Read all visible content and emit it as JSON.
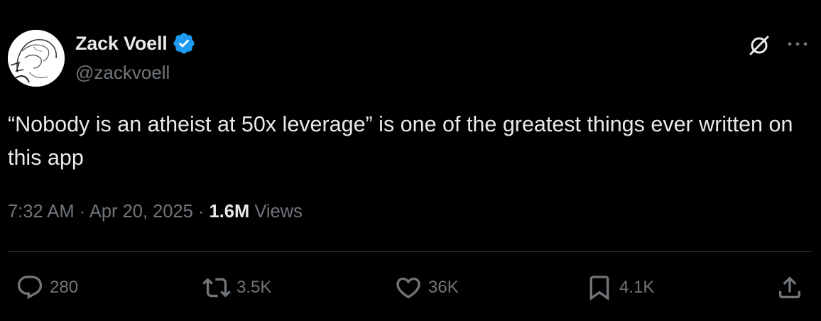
{
  "author": {
    "display_name": "Zack Voell",
    "handle": "@zackvoell",
    "verified": true
  },
  "tweet": {
    "text": "“Nobody is an atheist at 50x leverage” is one of the greatest things ever written on this app"
  },
  "meta": {
    "time": "7:32 AM",
    "separator": " · ",
    "date": "Apr 20, 2025",
    "views_count": "1.6M",
    "views_label": "Views"
  },
  "actions": {
    "replies": "280",
    "reposts": "3.5K",
    "likes": "36K",
    "bookmarks": "4.1K"
  },
  "colors": {
    "background": "#000000",
    "primary_text": "#e7e9ea",
    "secondary_text": "#71767b",
    "verified_badge": "#1d9bf0",
    "divider": "#2f3336"
  },
  "icons": [
    "avatar",
    "verified-badge-icon",
    "grok-icon",
    "more-icon",
    "reply-icon",
    "repost-icon",
    "like-icon",
    "bookmark-icon",
    "share-icon"
  ]
}
